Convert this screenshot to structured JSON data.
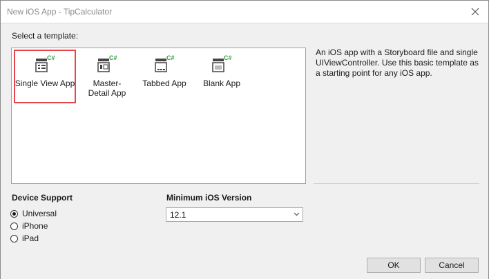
{
  "window": {
    "title": "New iOS App - TipCalculator"
  },
  "templates": {
    "heading": "Select a template:",
    "items": [
      {
        "label": "Single View App",
        "icon": "single-view-app-icon",
        "badge": "C#"
      },
      {
        "label": "Master-Detail App",
        "icon": "master-detail-app-icon",
        "badge": "C#"
      },
      {
        "label": "Tabbed App",
        "icon": "tabbed-app-icon",
        "badge": "C#"
      },
      {
        "label": "Blank App",
        "icon": "blank-app-icon",
        "badge": "C#"
      }
    ],
    "selected": "Single View App"
  },
  "description": "An iOS app with a Storyboard file and single UIViewController. Use this basic template as a starting point for any iOS app.",
  "device_support": {
    "label": "Device Support",
    "options": [
      {
        "label": "Universal",
        "checked": true
      },
      {
        "label": "iPhone",
        "checked": false
      },
      {
        "label": "iPad",
        "checked": false
      }
    ]
  },
  "min_ios": {
    "label": "Minimum iOS Version",
    "value": "12.1"
  },
  "buttons": {
    "ok": "OK",
    "cancel": "Cancel"
  },
  "colors": {
    "selection_outline": "#e5454a",
    "icon_badge": "#2e9a3e",
    "icon_body": "#444444"
  }
}
